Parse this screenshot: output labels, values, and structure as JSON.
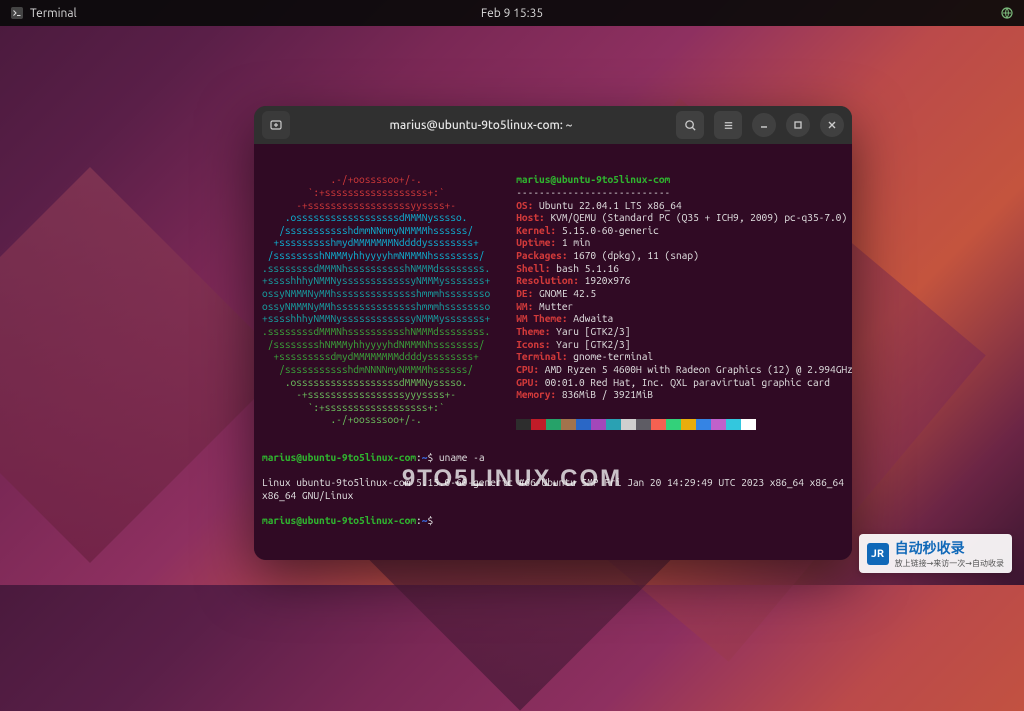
{
  "topbar": {
    "app_name": "Terminal",
    "clock": "Feb 9  15:35"
  },
  "window": {
    "title": "marius@ubuntu-9to5linux-com: ~"
  },
  "neofetch": {
    "user_host": "marius@ubuntu-9to5linux-com",
    "separator": "---------------------------",
    "info": {
      "os_label": "OS:",
      "os": " Ubuntu 22.04.1 LTS x86_64",
      "host_label": "Host:",
      "host": " KVM/QEMU (Standard PC (Q35 + ICH9, 2009) pc-q35-7.0)",
      "kernel_label": "Kernel:",
      "kernel": " 5.15.0-60-generic",
      "uptime_label": "Uptime:",
      "uptime": " 1 min",
      "packages_label": "Packages:",
      "packages": " 1670 (dpkg), 11 (snap)",
      "shell_label": "Shell:",
      "shell": " bash 5.1.16",
      "resolution_label": "Resolution:",
      "resolution": " 1920x976",
      "de_label": "DE:",
      "de": " GNOME 42.5",
      "wm_label": "WM:",
      "wm": " Mutter",
      "wmtheme_label": "WM Theme:",
      "wmtheme": " Adwaita",
      "theme_label": "Theme:",
      "theme": " Yaru [GTK2/3]",
      "icons_label": "Icons:",
      "icons": " Yaru [GTK2/3]",
      "terminal_label": "Terminal:",
      "terminal": " gnome-terminal",
      "cpu_label": "CPU:",
      "cpu": " AMD Ryzen 5 4600H with Radeon Graphics (12) @ 2.994GHz",
      "gpu_label": "GPU:",
      "gpu": " 00:01.0 Red Hat, Inc. QXL paravirtual graphic card",
      "memory_label": "Memory:",
      "memory": " 836MiB / 3921MiB"
    },
    "palette": [
      "#2d2d2d",
      "#c01c28",
      "#26a269",
      "#a2734c",
      "#2a67c6",
      "#a347ba",
      "#2aa1b3",
      "#cfcfcf",
      "#5e5c64",
      "#f66151",
      "#33d17a",
      "#e9ad0c",
      "#3584e4",
      "#c061cb",
      "#33c7de",
      "#ffffff"
    ]
  },
  "commands": {
    "prompt_user": "marius@ubuntu-9to5linux-com",
    "prompt_sep": ":",
    "prompt_path": "~",
    "prompt_char": "$ ",
    "cmd1": "uname -a",
    "out1": "Linux ubuntu-9to5linux-com 5.15.0-60-generic #66-Ubuntu SMP Fri Jan 20 14:29:49 UTC 2023 x86_64 x86_64 x86_64 GNU/Linux"
  },
  "brand": "9TO5LINUX.COM",
  "badge": {
    "initials": "JR",
    "title": "自动秒收录",
    "subtitle": "放上链接→来访一次→自动收录"
  },
  "logo_lines": [
    "            .-/+oossssoo+/-.",
    "        `:+ssssssssssssssssss+:`",
    "      -+ssssssssssssssssssyyssss+-",
    "    .ossssssssssssssssssdMMMNysssso.",
    "   /ssssssssssshdmmNNmmyNMMMMhssssss/",
    "  +ssssssssshmydMMMMMMMNddddyssssssss+",
    " /sssssssshNMMMyhhyyyyhmNMMMNhssssssss/",
    ".ssssssssdMMMNhsssssssssshNMMMdssssssss.",
    "+sssshhhyNMMNyssssssssssssyNMMMysssssss+",
    "ossyNMMMNyMMhsssssssssssssshmmmhssssssso",
    "ossyNMMMNyMMhsssssssssssssshmmmhssssssso",
    "+sssshhhyNMMNyssssssssssssyNMMMysssssss+",
    ".ssssssssdMMMNhsssssssssshNMMMdssssssss.",
    " /sssssssshNMMMyhhyyyyhdNMMMNhssssssss/",
    "  +sssssssssdmydMMMMMMMMddddyssssssss+",
    "   /ssssssssssshdmNNNNmyNMMMMhssssss/",
    "    .ossssssssssssssssssdMMMNysssso.",
    "      -+sssssssssssssssssyyyssss+-",
    "        `:+ssssssssssssssssss+:`",
    "            .-/+oossssoo+/-."
  ]
}
